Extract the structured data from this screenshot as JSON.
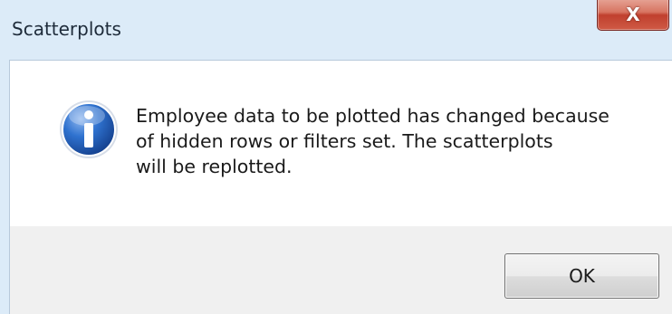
{
  "window": {
    "title": "Scatterplots",
    "close_label": "X"
  },
  "dialog": {
    "icon": "info-icon",
    "message": "Employee data to be plotted has changed because\nof hidden rows or filters set. The scatterplots\nwill be replotted.",
    "ok_label": "OK"
  },
  "colors": {
    "title_bar": "#dcebf8",
    "close_button": "#c7412f",
    "info_icon": "#1f5fb8"
  }
}
